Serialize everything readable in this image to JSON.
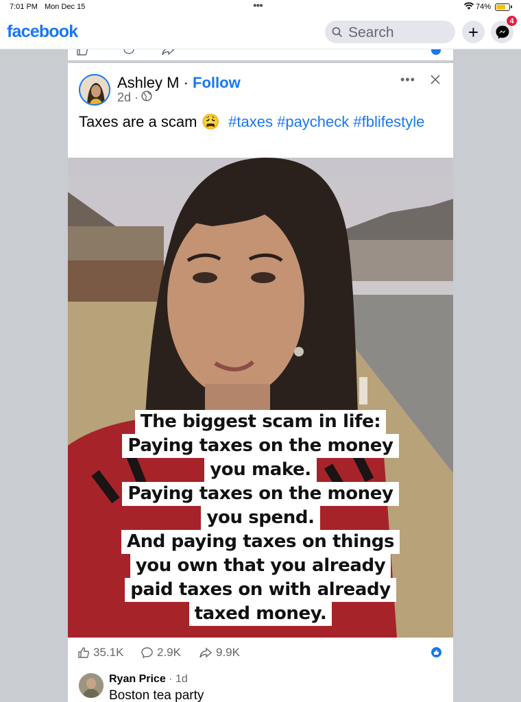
{
  "status_bar": {
    "time": "7:01 PM",
    "date": "Mon Dec 15",
    "battery": "74%",
    "battery_level": 0.74
  },
  "app_bar": {
    "logo": "facebook",
    "search_placeholder": "Search",
    "plus_label": "+",
    "messenger_badge": "4"
  },
  "post": {
    "author": "Ashley M",
    "separator": " · ",
    "follow_label": "Follow",
    "age": "2d ·",
    "caption_text": "Taxes are a scam 😩",
    "hashtags": [
      "#taxes",
      "#paycheck",
      "#fblifestyle"
    ],
    "overlay_lines": [
      "The biggest scam in life:",
      "Paying taxes on the money",
      "you make.",
      "Paying taxes on the money",
      "you spend.",
      "And paying taxes on things",
      "you own that you already",
      "paid taxes on with already",
      "taxed money."
    ],
    "likes": "35.1K",
    "comments": "2.9K",
    "shares": "9.9K"
  },
  "comment": {
    "author": "Ryan Price",
    "time": " · 1d",
    "text": "Boston tea party"
  },
  "colors": {
    "brand": "#1877f2",
    "badge": "#e41e3f",
    "feed_bg": "#c9ccd1"
  }
}
